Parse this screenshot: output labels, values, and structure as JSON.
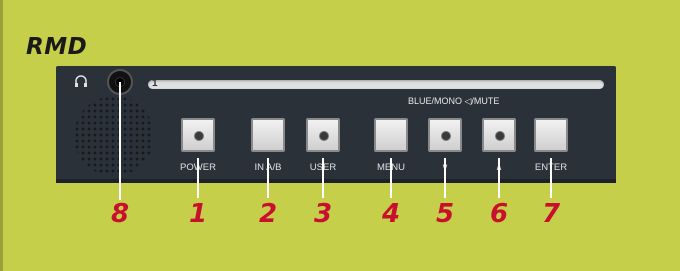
{
  "title": "RMD",
  "group_label": "BLUE/MONO ◁/MUTE",
  "slot_number": "1",
  "buttons": [
    {
      "label": "POWER",
      "led": true,
      "callout": "1"
    },
    {
      "label": "IN A/B",
      "led": false,
      "callout": "2"
    },
    {
      "label": "USER",
      "led": true,
      "callout": "3"
    },
    {
      "label": "MENU",
      "led": false,
      "callout": "4"
    },
    {
      "label": "∨",
      "led": true,
      "callout": "5"
    },
    {
      "label": "∧",
      "led": true,
      "callout": "6"
    },
    {
      "label": "ENTER",
      "led": false,
      "callout": "7"
    }
  ],
  "jack_callout": "8",
  "colors": {
    "background": "#c6cf49",
    "panel": "#2b3139",
    "callout": "#c8102e"
  }
}
